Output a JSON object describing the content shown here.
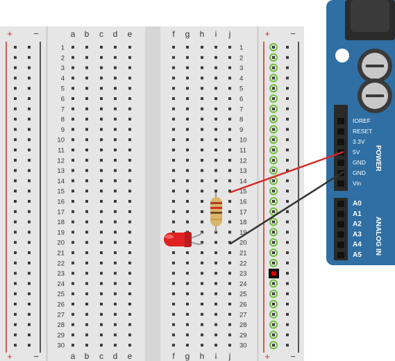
{
  "breadboard": {
    "plus_label": "+",
    "minus_label": "−",
    "columns_left": [
      "a",
      "b",
      "c",
      "d",
      "e"
    ],
    "columns_right": [
      "f",
      "g",
      "h",
      "i",
      "j"
    ],
    "rows": [
      "1",
      "2",
      "3",
      "4",
      "5",
      "6",
      "7",
      "8",
      "9",
      "10",
      "11",
      "12",
      "13",
      "14",
      "15",
      "16",
      "17",
      "18",
      "19",
      "20",
      "21",
      "22",
      "23",
      "24",
      "25",
      "26",
      "27",
      "28",
      "29",
      "30"
    ],
    "highlighted_rail_color": "#6fbf3a",
    "selected_hole_color": "#e00000"
  },
  "arduino": {
    "board_color": "#2f6fa3",
    "power_pins": [
      "IOREF",
      "RESET",
      "3.3V",
      "5V",
      "GND",
      "GND",
      "Vin"
    ],
    "power_header_label": "POWER",
    "analog_pins": [
      "A0",
      "A1",
      "A2",
      "A3",
      "A4",
      "A5"
    ],
    "analog_header_label": "ANALOG IN"
  },
  "components": {
    "resistor": {
      "body_color": "#d9b56e"
    },
    "led": {
      "color": "#e02020"
    }
  },
  "wires": [
    {
      "name": "5v-wire",
      "color": "#d42a2a",
      "from": "5V",
      "to": "row 15 j"
    },
    {
      "name": "gnd-wire",
      "color": "#333333",
      "from": "GND",
      "to": "row 20 j"
    }
  ]
}
